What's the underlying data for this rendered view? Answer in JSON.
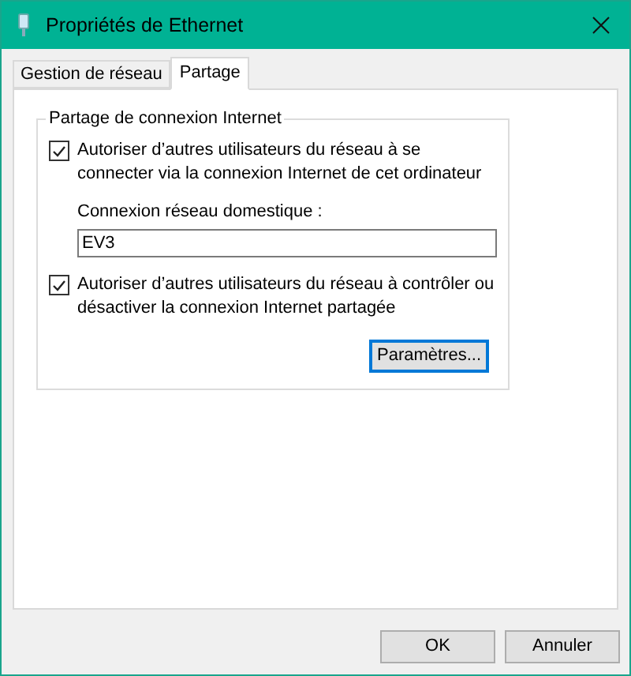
{
  "window": {
    "title": "Propriétés de Ethernet"
  },
  "tabs": [
    {
      "label": "Gestion de réseau",
      "selected": false
    },
    {
      "label": "Partage",
      "selected": true
    }
  ],
  "group": {
    "title": "Partage de connexion Internet",
    "allow_connect": {
      "label": "Autoriser d’autres utilisateurs du réseau à se connecter via la connexion Internet de cet ordinateur",
      "checked": true
    },
    "home_network": {
      "label": "Connexion réseau domestique :",
      "value": "EV3"
    },
    "allow_control": {
      "label": "Autoriser d’autres utilisateurs du réseau à contrôler ou désactiver la connexion Internet partagée",
      "checked": true
    },
    "settings_button": "Paramètres..."
  },
  "buttons": [
    {
      "label": "OK",
      "default": false
    },
    {
      "label": "Annuler",
      "default": false
    }
  ]
}
